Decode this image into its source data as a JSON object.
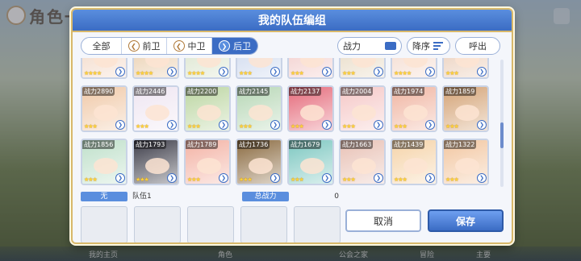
{
  "background": {
    "title": "角色一览",
    "bottom_labels": [
      "我的主页",
      "角色",
      "公会之家",
      "冒险",
      "主要"
    ]
  },
  "dialog": {
    "title": "我的队伍编组"
  },
  "filters": [
    {
      "label": "全部",
      "active": false,
      "icon": ""
    },
    {
      "label": "前卫",
      "active": false,
      "icon": "position-front-icon"
    },
    {
      "label": "中卫",
      "active": false,
      "icon": "position-middle-icon"
    },
    {
      "label": "后卫",
      "active": true,
      "icon": "position-back-icon"
    }
  ],
  "sort": {
    "label": "战力"
  },
  "order": {
    "label": "降序"
  },
  "call_button": {
    "label": "呼出"
  },
  "characters": [
    {
      "power": "",
      "stars": "★★★★",
      "color": "#f2d6c3"
    },
    {
      "power": "",
      "stars": "★★★★",
      "color": "#e7c9a5"
    },
    {
      "power": "",
      "stars": "★★★★",
      "color": "#d7e2c8"
    },
    {
      "power": "",
      "stars": "★★★",
      "color": "#c9d5ec"
    },
    {
      "power": "",
      "stars": "★★★",
      "color": "#f1c8c6"
    },
    {
      "power": "",
      "stars": "★★★",
      "color": "#e6d7bf"
    },
    {
      "power": "",
      "stars": "★★★★",
      "color": "#f3d7c9"
    },
    {
      "power": "",
      "stars": "★★★",
      "color": "#e8c9b3"
    },
    {
      "power": "战力2890",
      "stars": "★★★",
      "color": "#f0c9a8"
    },
    {
      "power": "战力2446",
      "stars": "★★★",
      "color": "#efe6f2"
    },
    {
      "power": "战力2200",
      "stars": "★★★",
      "color": "#bcd6a2"
    },
    {
      "power": "战力2145",
      "stars": "★★★",
      "color": "#b7d7b6"
    },
    {
      "power": "战力2137",
      "stars": "★★★",
      "color": "#e56a7a"
    },
    {
      "power": "战力2004",
      "stars": "★★★",
      "color": "#f5c8c7"
    },
    {
      "power": "战力1974",
      "stars": "★★★",
      "color": "#f0b5a2"
    },
    {
      "power": "战力1859",
      "stars": "★★★",
      "color": "#d4a376"
    },
    {
      "power": "战力1856",
      "stars": "★★★",
      "color": "#bfe0ca"
    },
    {
      "power": "战力1793",
      "stars": "★★★",
      "color": "#3c3c48"
    },
    {
      "power": "战力1789",
      "stars": "★★★",
      "color": "#f3b2a4"
    },
    {
      "power": "战力1736",
      "stars": "★★★",
      "color": "#8a6a40"
    },
    {
      "power": "战力1679",
      "stars": "★★★",
      "color": "#7cc7c0"
    },
    {
      "power": "战力1663",
      "stars": "★★★",
      "color": "#e8c1b5"
    },
    {
      "power": "战力1439",
      "stars": "★★★",
      "color": "#f5d3a8"
    },
    {
      "power": "战力1322",
      "stars": "★★★",
      "color": "#f2c6a0"
    }
  ],
  "team": {
    "slot_tag": "无",
    "name": "队伍1",
    "total_power_label": "总战力",
    "total_power_value": "0"
  },
  "buttons": {
    "cancel": "取消",
    "save": "保存"
  }
}
